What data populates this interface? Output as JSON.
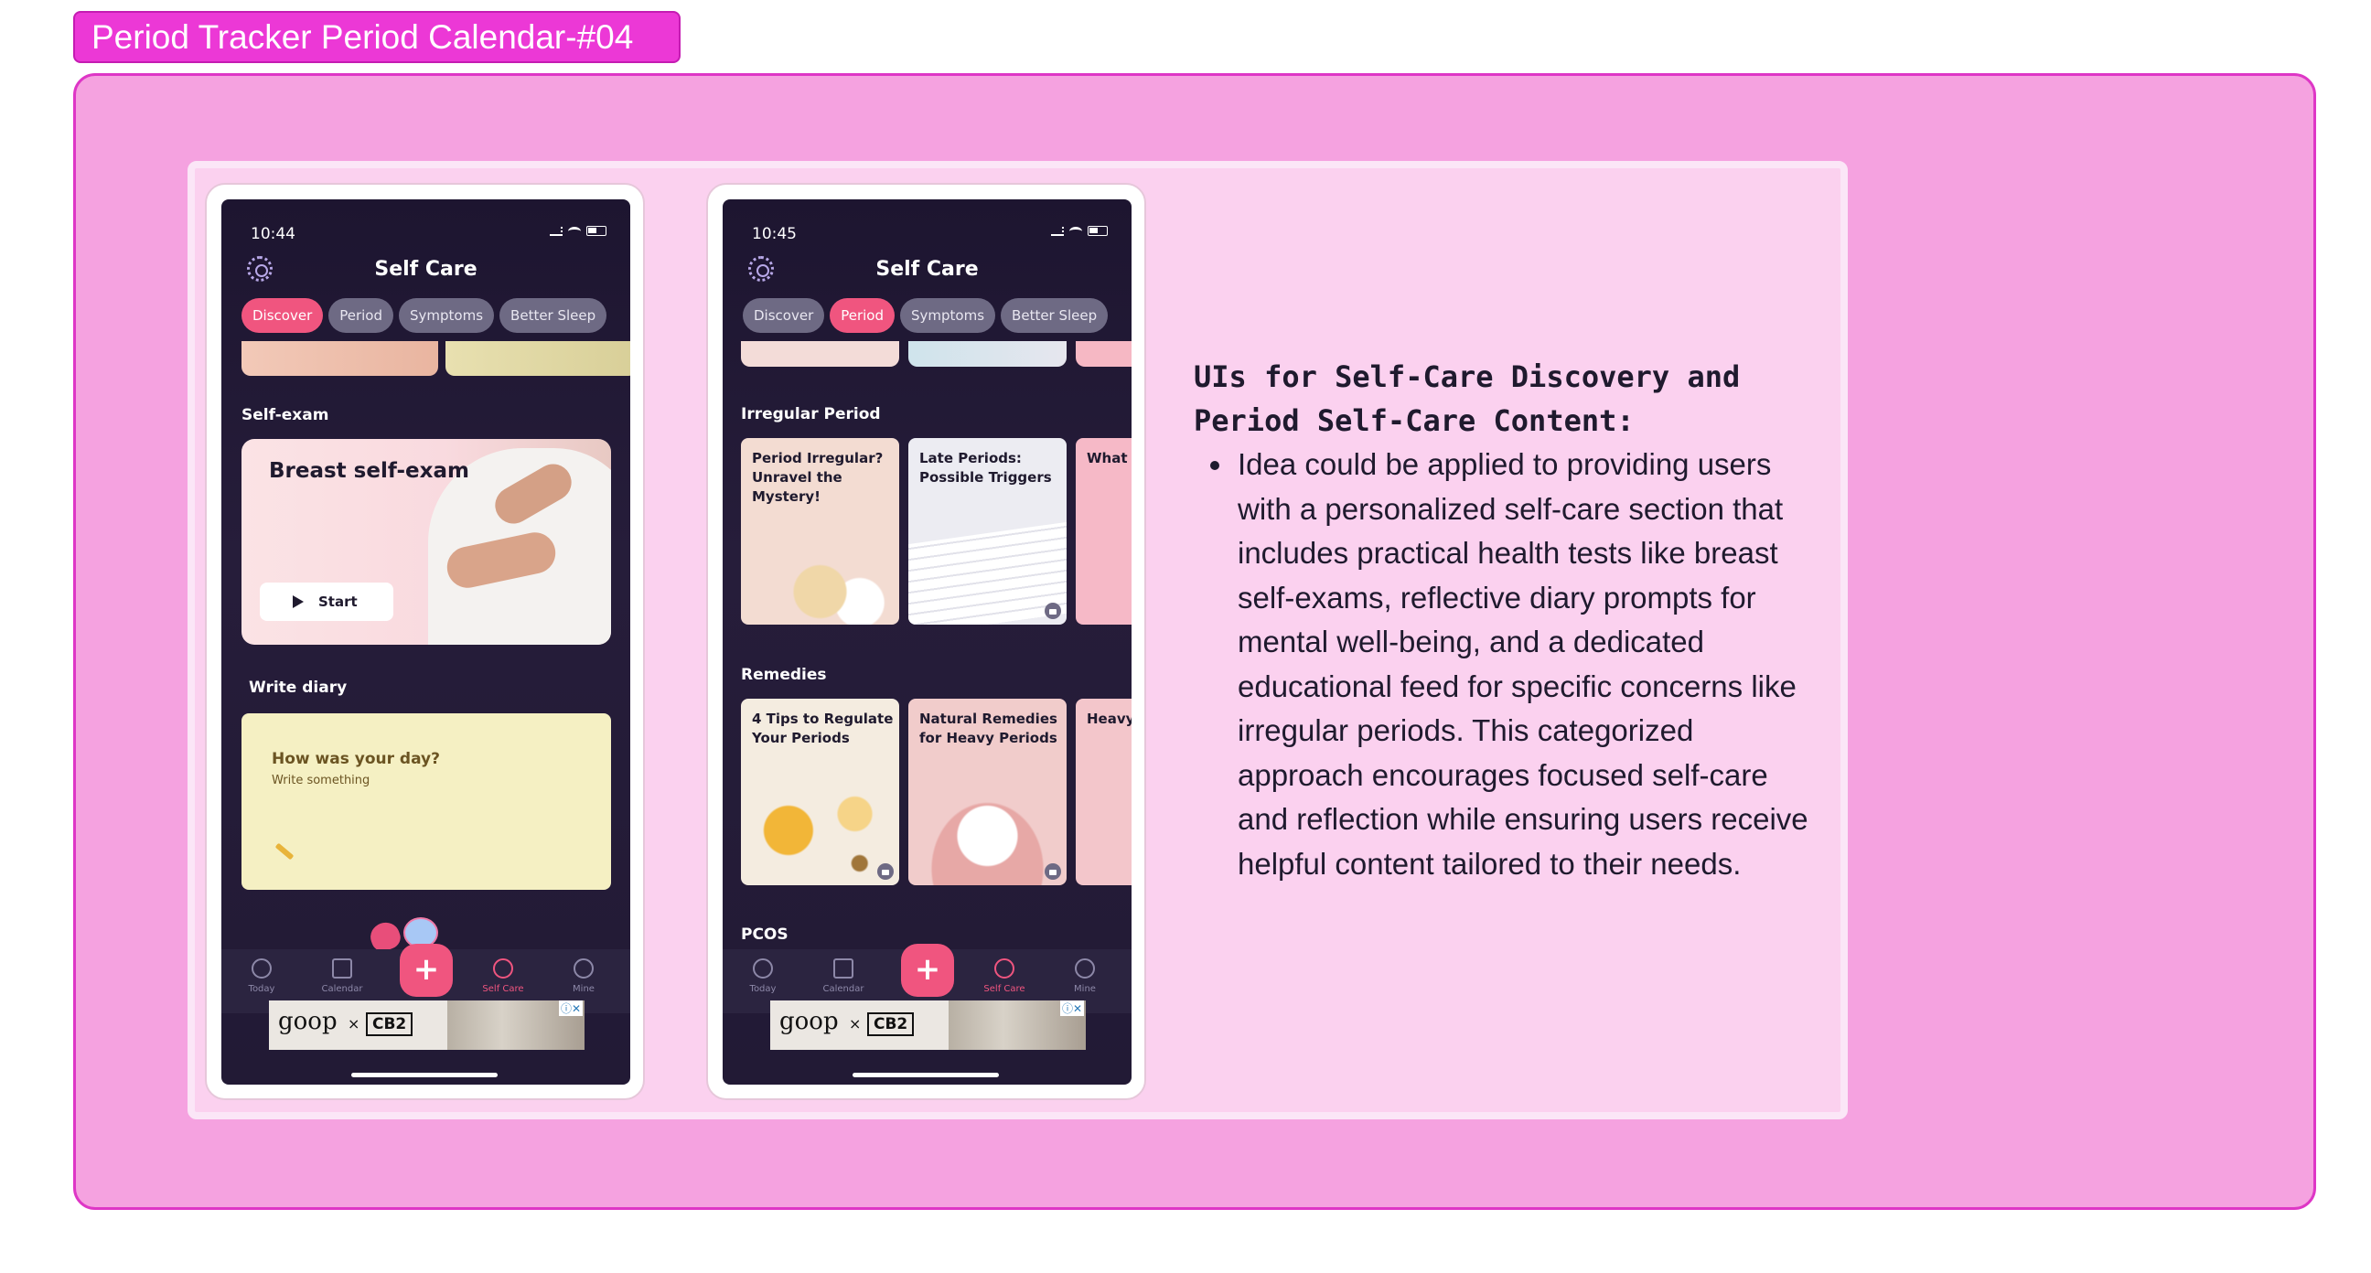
{
  "board": {
    "title": "Period Tracker Period Calendar-#04"
  },
  "screen1": {
    "time": "10:44",
    "title": "Self Care",
    "tabs": [
      "Discover",
      "Period",
      "Symptoms",
      "Better Sleep"
    ],
    "active_tab": "Discover",
    "self_exam_label": "Self-exam",
    "breast_card": {
      "title": "Breast self-exam",
      "button": "Start"
    },
    "diary_label": "Write diary",
    "diary_card": {
      "title": "How was your day?",
      "placeholder": "Write something"
    },
    "nav": [
      "Today",
      "Calendar",
      "Self Care",
      "Mine"
    ],
    "active_nav": "Self Care"
  },
  "screen2": {
    "time": "10:45",
    "title": "Self Care",
    "tabs": [
      "Discover",
      "Period",
      "Symptoms",
      "Better Sleep"
    ],
    "active_tab": "Period",
    "irregular_label": "Irregular Period",
    "irregular_cards": [
      "Period Irregular? Unravel the Mystery!",
      "Late Periods: Possible Triggers",
      "What A Period"
    ],
    "remedies_label": "Remedies",
    "remedy_cards": [
      "4 Tips to Regulate Your Periods",
      "Natural Remedies for Heavy Periods",
      "Heavy Effecti"
    ],
    "pcos_label": "PCOS",
    "nav": [
      "Today",
      "Calendar",
      "Self Care",
      "Mine"
    ],
    "active_nav": "Self Care"
  },
  "ad": {
    "brand": "goop",
    "times": "×",
    "partner": "CB2",
    "adchoice": "ⓘ✕"
  },
  "description": {
    "heading": "UIs for Self-Care Discovery and Period Self-Care Content:",
    "body": "Idea could be applied to providing users with a personalized self-care section that includes practical health tests like breast self-exams, reflective diary prompts for mental well-being, and a dedicated educational feed for specific concerns like irregular periods. This categorized approach encourages focused self-care and reflection while ensuring users receive helpful content tailored to their needs."
  },
  "colors": {
    "accent": "#f0557f",
    "board": "#f5a2e0",
    "board_border": "#de36c6",
    "panel": "#fbd1ef",
    "screen_bg": "#1d1530"
  },
  "icons": [
    "settings-icon",
    "play-icon",
    "pencil-icon",
    "lock-icon",
    "plus-icon",
    "today-icon",
    "calendar-icon",
    "self-care-icon",
    "mine-icon"
  ]
}
